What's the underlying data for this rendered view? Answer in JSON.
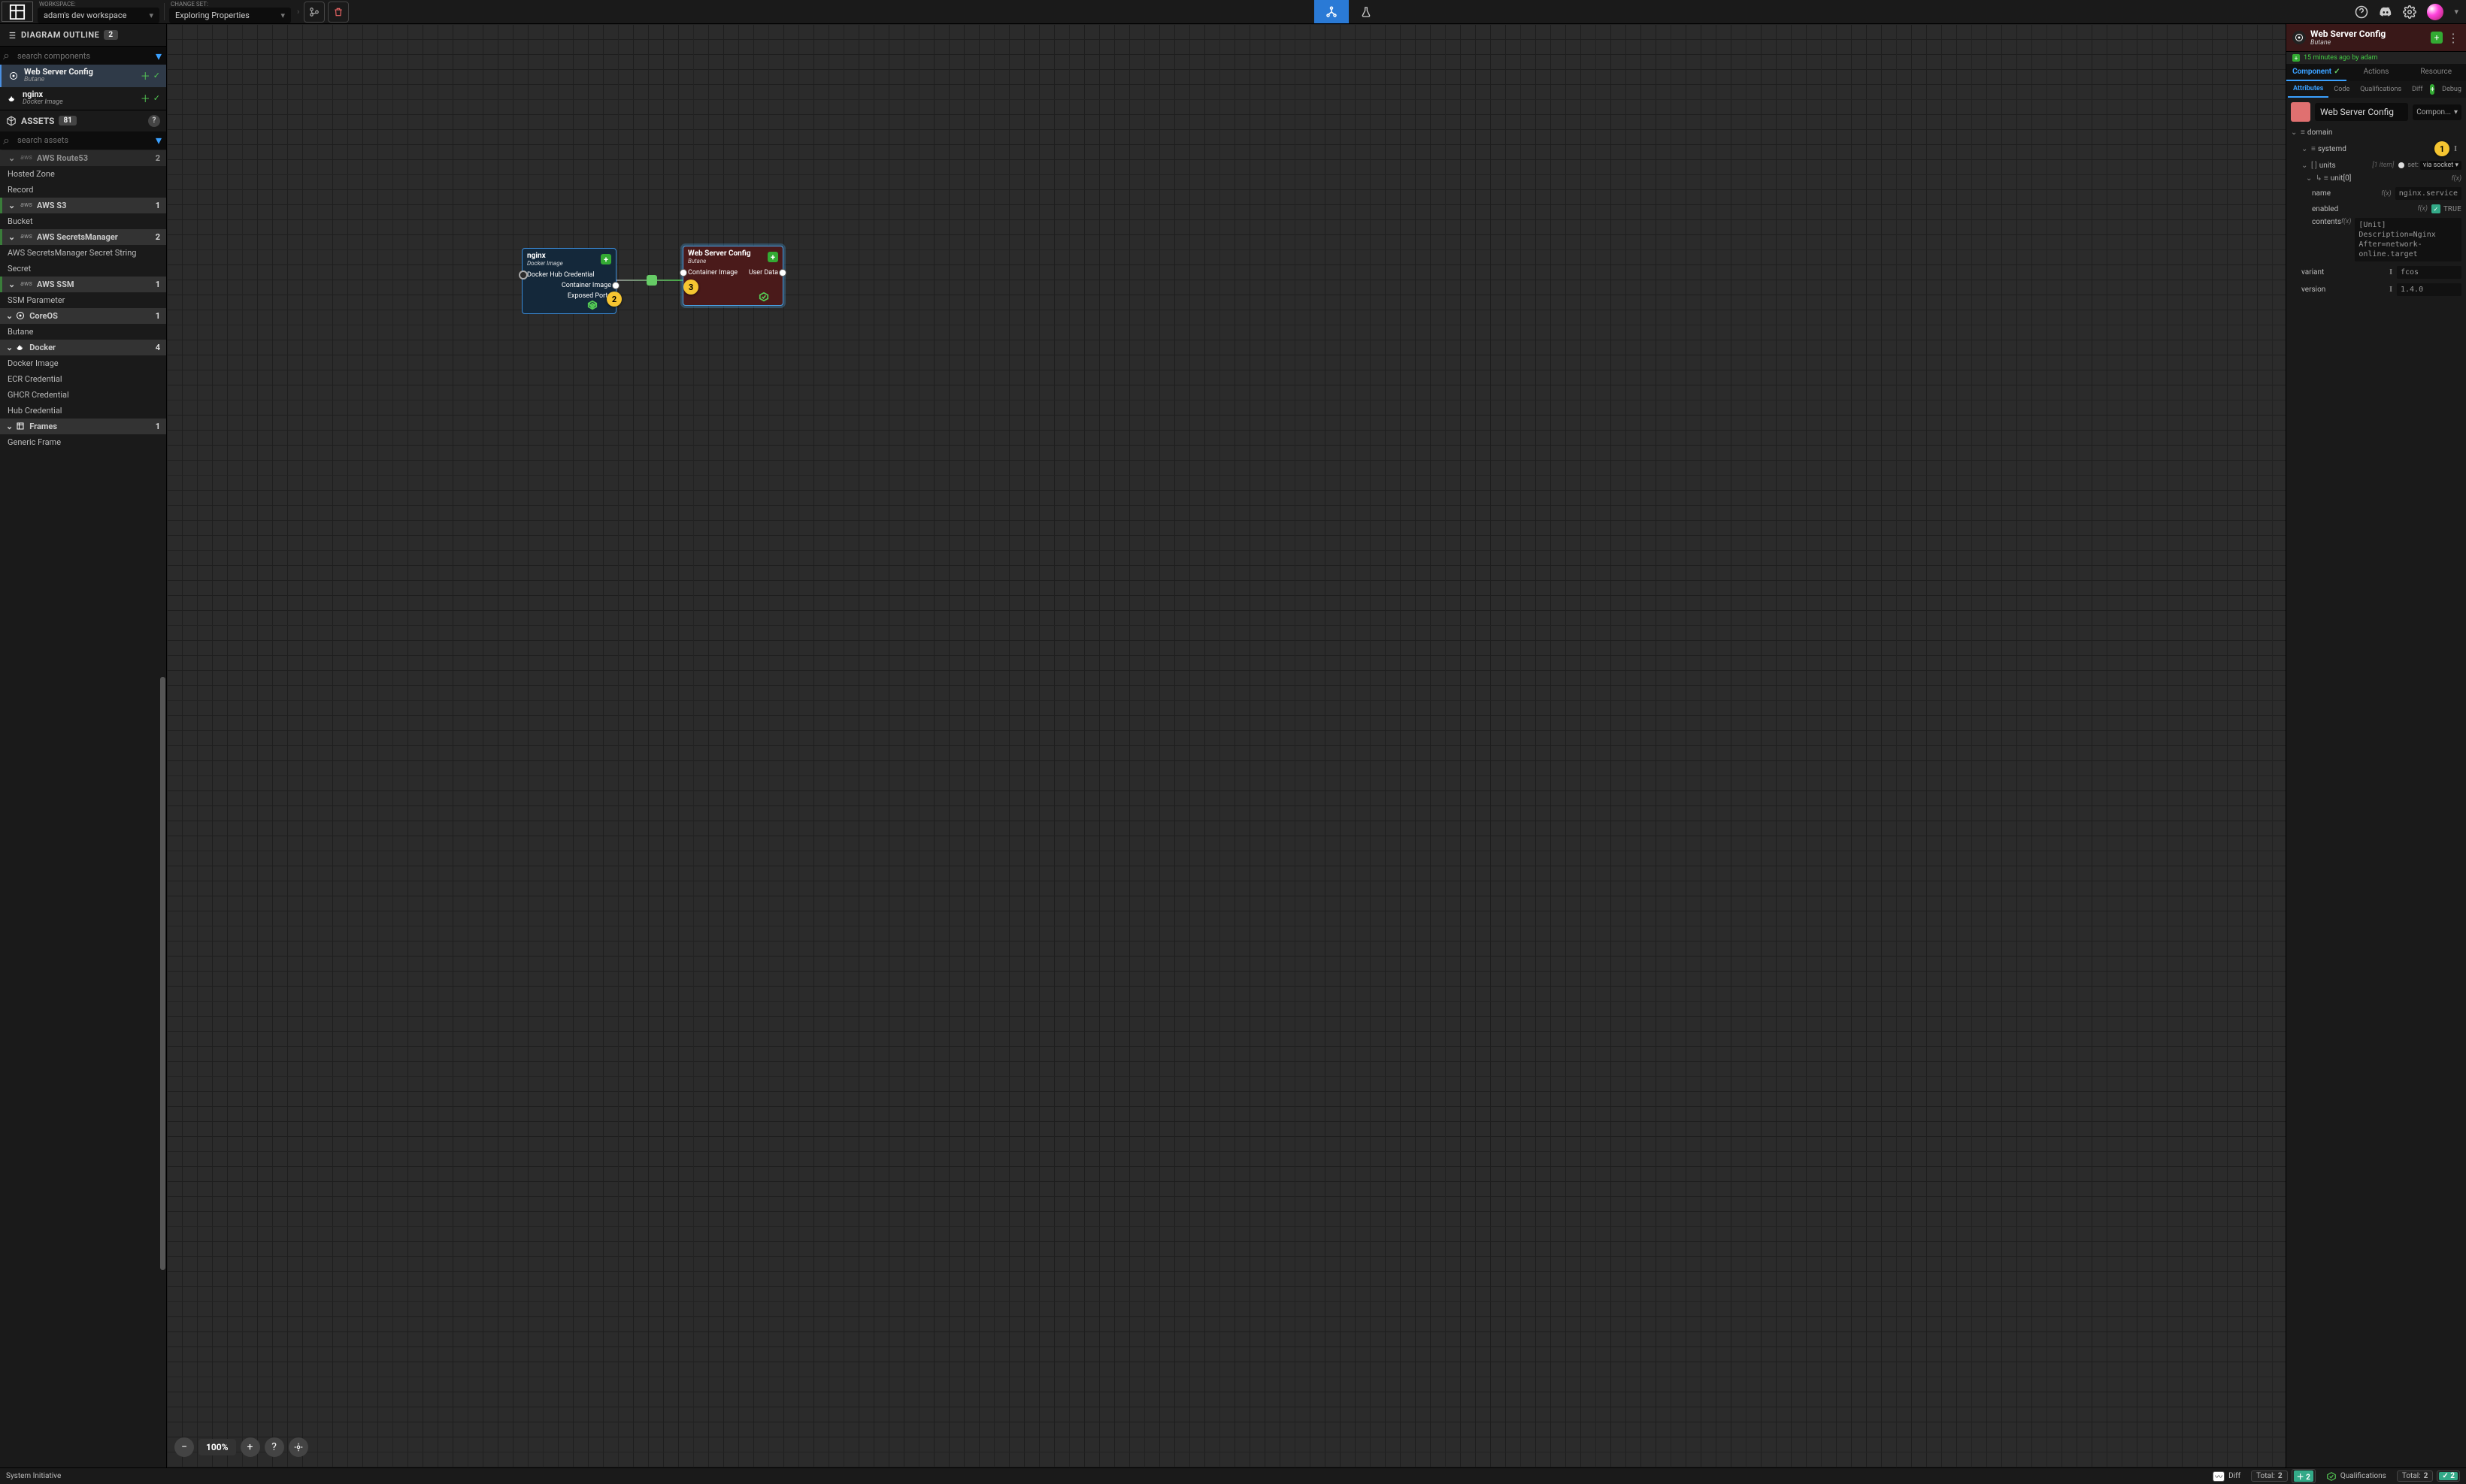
{
  "topbar": {
    "workspace_label": "WORKSPACE:",
    "workspace_value": "adam's dev workspace",
    "changeset_label": "CHANGE SET:",
    "changeset_value": "Exploring Properties"
  },
  "outline": {
    "title": "DIAGRAM OUTLINE",
    "count": "2",
    "search_placeholder": "search components",
    "items": [
      {
        "name": "Web Server Config",
        "sub": "Butane",
        "active": true
      },
      {
        "name": "nginx",
        "sub": "Docker Image",
        "active": false
      }
    ]
  },
  "assets": {
    "title": "ASSETS",
    "count": "81",
    "search_placeholder": "search assets",
    "categories": [
      {
        "name": "AWS Route53",
        "provider": "aws",
        "count": "2",
        "cut": true,
        "children": [
          "Hosted Zone",
          "Record"
        ]
      },
      {
        "name": "AWS S3",
        "provider": "aws",
        "count": "1",
        "children": [
          "Bucket"
        ]
      },
      {
        "name": "AWS SecretsManager",
        "provider": "aws",
        "count": "2",
        "children": [
          "AWS SecretsManager Secret String",
          "Secret"
        ]
      },
      {
        "name": "AWS SSM",
        "provider": "aws",
        "count": "1",
        "children": [
          "SSM Parameter"
        ]
      },
      {
        "name": "CoreOS",
        "provider": "coreos",
        "count": "1",
        "children": [
          "Butane"
        ]
      },
      {
        "name": "Docker",
        "provider": "docker",
        "count": "4",
        "children": [
          "Docker Image",
          "ECR Credential",
          "GHCR Credential",
          "Hub Credential"
        ]
      },
      {
        "name": "Frames",
        "provider": "frames",
        "count": "1",
        "children": [
          "Generic Frame"
        ]
      }
    ]
  },
  "canvas": {
    "nginx": {
      "name": "nginx",
      "sub": "Docker Image",
      "sockets_left": [
        "Docker Hub Credential"
      ],
      "sockets_right": [
        "Container Image",
        "Exposed Ports"
      ]
    },
    "web": {
      "name": "Web Server Config",
      "sub": "Butane",
      "sockets_left": [
        "Container Image"
      ],
      "sockets_right": [
        "User Data"
      ]
    },
    "zoom": "100%",
    "badges": {
      "b2": "2",
      "b3": "3"
    }
  },
  "right": {
    "title": "Web Server Config",
    "sub": "Butane",
    "meta": "15 minutes ago by adam",
    "tabs1": [
      "Component",
      "Actions",
      "Resource"
    ],
    "tabs2": [
      "Attributes",
      "Code",
      "Qualifications",
      "Diff",
      "Debug"
    ],
    "name_input": "Web Server Config",
    "type_select": "Compon...",
    "badge1": "1",
    "attrs": {
      "domain": "domain",
      "systemd": "systemd",
      "units": "units",
      "units_meta": "[1 item]",
      "units_set_label": "set:",
      "units_set_value": "via socket ▾",
      "unit0": "unit[0]",
      "name_lbl": "name",
      "name_val": "nginx.service",
      "enabled_lbl": "enabled",
      "enabled_val": "TRUE",
      "contents_lbl": "contents",
      "contents_val": "[Unit]\nDescription=Nginx\nAfter=network-online.target",
      "variant_lbl": "variant",
      "variant_val": "fcos",
      "version_lbl": "version",
      "version_val": "1.4.0"
    }
  },
  "status": {
    "brand": "System Initiative",
    "diff": "Diff",
    "total_lbl": "Total:",
    "total_val": "2",
    "changed_val": "2",
    "qual": "Qualifications",
    "qual_total": "2",
    "qual_changed": "2"
  }
}
